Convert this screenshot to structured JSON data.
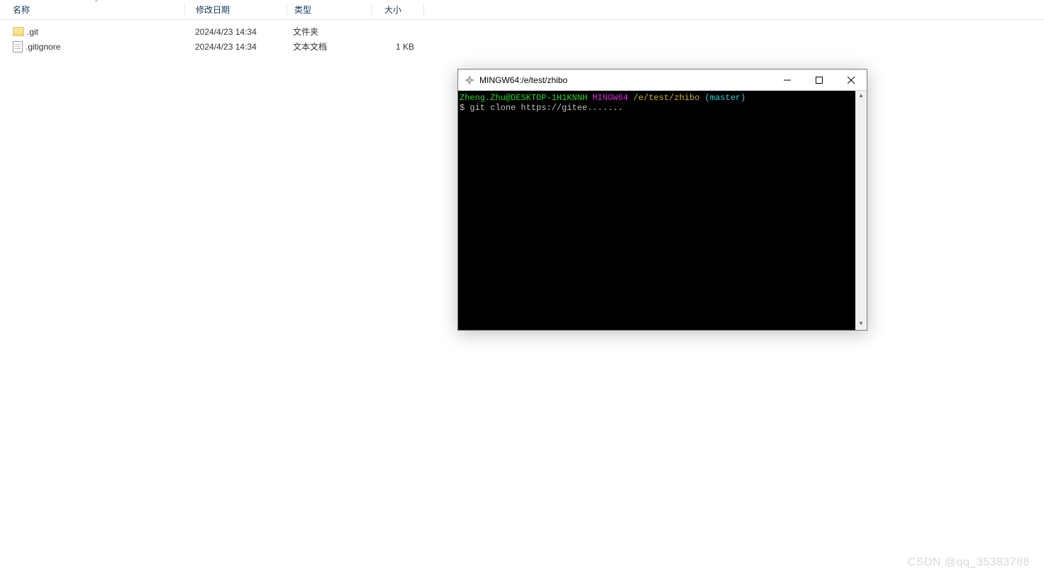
{
  "explorer": {
    "columns": {
      "name": "名称",
      "modified": "修改日期",
      "type": "类型",
      "size": "大小"
    },
    "rows": [
      {
        "name": ".git",
        "modified": "2024/4/23 14:34",
        "type": "文件夹",
        "size": "",
        "icon": "folder"
      },
      {
        "name": ".gitignore",
        "modified": "2024/4/23 14:34",
        "type": "文本文档",
        "size": "1 KB",
        "icon": "file"
      }
    ]
  },
  "terminal": {
    "title": "MINGW64:/e/test/zhibo",
    "prompt": {
      "user": "Zheng.Zhu@DESKTOP-1H1KNNH",
      "host": "MINGW64",
      "path": "/e/test/zhibo",
      "branch": "(master)"
    },
    "command_prefix": "$",
    "command": "git clone https://gitee......."
  },
  "watermark": "CSDN @qq_35383788"
}
